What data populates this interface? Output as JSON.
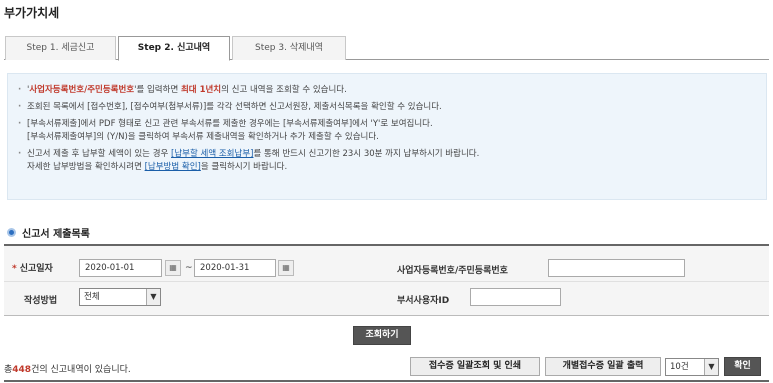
{
  "page": {
    "title": "부가가치세"
  },
  "tabs": [
    {
      "label": "Step 1. 세금신고"
    },
    {
      "label": "Step 2. 신고내역"
    },
    {
      "label": "Step 3. 삭제내역"
    }
  ],
  "notice": {
    "item1": {
      "prefix": "'",
      "highlight1": "사업자등록번호/주민등록번호",
      "middle": "'를 입력하면 ",
      "highlight2": "최대 1년치",
      "suffix": "의 신고 내역을 조회할 수 있습니다."
    },
    "item2": "조회된 목록에서 [접수번호], [접수여부(첨부서류)]를 각각 선택하면 신고서원장, 제출서식목록을 확인할 수 있습니다.",
    "item3_line1": "[부속서류제출]에서 PDF 형태로 신고 관련 부속서류를 제출한 경우에는 [부속서류제출여부]에서 'Y'로 보여집니다.",
    "item3_line2": "[부속서류제출여부]의 (Y/N)을 클릭하여 부속서류 제출내역을 확인하거나 추가 제출할 수 있습니다.",
    "item4": {
      "line1_prefix": "신고서 제출 후 납부할 세액이 있는 경우 ",
      "link1": "[납부할 세액 조회납부]",
      "line1_suffix": "를 통해 반드시 신고기한 23시 30분 까지 납부하시기 바랍니다.",
      "line2_prefix": "자세한 납부방법을 확인하시려면 ",
      "link2": "[납부방법 확인]",
      "line2_suffix": "을 클릭하시기 바랍니다."
    }
  },
  "section": {
    "title": "신고서 제출목록"
  },
  "search": {
    "date_label": "신고일자",
    "required_mark": "*",
    "date_from": "2020-01-01",
    "date_to": "2020-01-31",
    "tilde": "~",
    "biz_no_label": "사업자등록번호/주민등록번호",
    "biz_no_value": "",
    "method_label": "작성방법",
    "method_value": "전체",
    "dept_user_label": "부서사용자ID",
    "dept_user_value": "",
    "search_button": "조회하기"
  },
  "results": {
    "count_prefix": "총",
    "count": "448",
    "count_suffix": "건의 신고내역이 있습니다.",
    "bulk_print_button": "접수증 일괄조회 및 인쇄",
    "individual_print_button": "개별접수증 일괄 출력",
    "page_size_value": "10건",
    "confirm_button": "확인"
  },
  "icons": {
    "calendar": "calendar-icon",
    "dropdown": "chevron-down-icon",
    "section_bullet": "circle-bullet-icon"
  }
}
